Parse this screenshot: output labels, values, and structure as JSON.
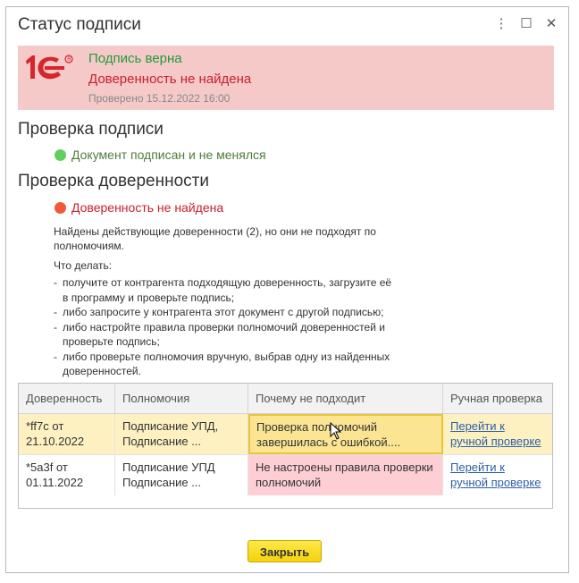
{
  "window": {
    "title": "Статус подписи",
    "more_glyph": "⋮",
    "maximize_glyph": "☐",
    "close_glyph": "✕"
  },
  "banner": {
    "status_ok": "Подпись верна",
    "status_error": "Доверенность не найдена",
    "checked": "Проверено 15.12.2022 16:00",
    "logo": "1c-logo",
    "bg_color": "#f6c9c9"
  },
  "signature_check": {
    "heading": "Проверка подписи",
    "status": "Документ подписан и не менялся",
    "status_color": "#1e9b3c",
    "dot_color": "#5fd05f"
  },
  "poa_check": {
    "heading": "Проверка доверенности",
    "status": "Доверенность не найдена",
    "status_color": "#c8202c",
    "dot_color": "#f05a3a",
    "found_line1": "Найдены действующие доверенности (2), но они не подходят по",
    "found_line2": "полномочиям.",
    "what_to_do": "Что делать:",
    "steps": [
      {
        "l1": "получите от контрагента подходящую доверенность, загрузите её",
        "l2": "в программу и проверьте подпись;"
      },
      {
        "l1": "либо запросите у контрагента этот документ с другой подписью;",
        "l2": ""
      },
      {
        "l1": "либо настройте правила проверки полномочий доверенностей и",
        "l2": "проверьте подпись;"
      },
      {
        "l1": "либо проверьте полномочия вручную, выбрав одну из найденных",
        "l2": "доверенностей."
      }
    ]
  },
  "table": {
    "columns": [
      "Доверенность",
      "Полномочия",
      "Почему не подходит",
      "Ручная проверка"
    ],
    "rows": [
      {
        "poa_l1": "*ff7c от",
        "poa_l2": "21.10.2022",
        "powers_l1": "Подписание УПД,",
        "powers_l2": "Подписание ...",
        "reason_l1": "Проверка полномочий",
        "reason_l2": "завершилась с ошибкой....",
        "link_l1": "Перейти к",
        "link_l2": "ручной проверке"
      },
      {
        "poa_l1": "*5a3f от",
        "poa_l2": "01.11.2022",
        "powers_l1": "Подписание УПД",
        "powers_l2": "Подписание ...",
        "reason_l1": "Не настроены правила проверки",
        "reason_l2": "полномочий",
        "link_l1": "Перейти к",
        "link_l2": "ручной проверке"
      }
    ],
    "selected_row_color": "#fdf1c2",
    "selected_cell_color": "#fce592",
    "error_cell_color": "#fdcfd4"
  },
  "footer": {
    "close_label": "Закрыть"
  }
}
